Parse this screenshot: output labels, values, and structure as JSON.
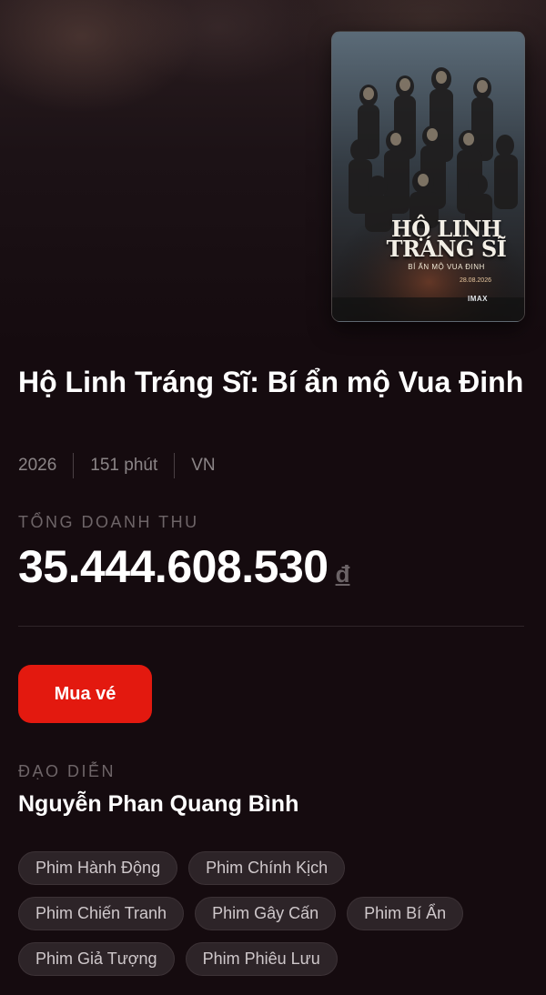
{
  "movie": {
    "title": "Hộ Linh Tráng Sĩ: Bí ẩn mộ Vua Đinh",
    "year": "2026",
    "duration": "151 phút",
    "country": "VN",
    "poster": {
      "title": "HỘ LINH TRÁNG SĨ",
      "subtitle": "BÍ ẨN MỘ VUA ĐINH",
      "date": "28.08.2026",
      "format": "IMAX"
    }
  },
  "revenue": {
    "label": "TỔNG DOANH THU",
    "value": "35.444.608.530",
    "unit": "đ"
  },
  "actions": {
    "buy_label": "Mua vé"
  },
  "director": {
    "label": "ĐẠO DIỄN",
    "name": "Nguyễn Phan Quang Bình"
  },
  "genres": [
    "Phim Hành Động",
    "Phim Chính Kịch",
    "Phim Chiến Tranh",
    "Phim Gây Cấn",
    "Phim Bí Ẩn",
    "Phim Giả Tượng",
    "Phim Phiêu Lưu"
  ],
  "colors": {
    "background": "#150b0f",
    "accent": "#e3190f",
    "muted_text": "#8b8587",
    "chip_bg": "#2d2428"
  }
}
